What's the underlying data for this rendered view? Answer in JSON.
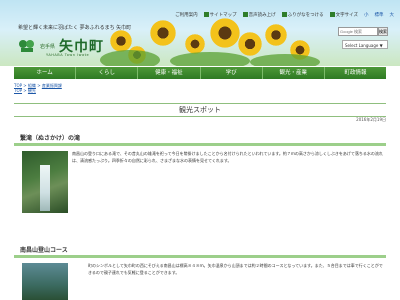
{
  "header": {
    "top_links": [
      "ご利用案内",
      "サイトマップ",
      "音声読み上げ",
      "ふりがなをつける",
      "文字サイズ",
      "小",
      "標準",
      "大"
    ],
    "tagline": "希望と輝く未来に羽ばたく 夢あふれるまち 矢巾町",
    "logo_prefix": "岩手県",
    "logo_name": "矢巾町",
    "logo_en": "YAHABA Town Iwate",
    "search_placeholder": "Google 検索",
    "search_button": "検索",
    "language_select": "Select Language ▼"
  },
  "nav": {
    "items": [
      "ホーム",
      "くらし",
      "健康・福祉",
      "学び",
      "観光・産業",
      "町政情報"
    ]
  },
  "breadcrumb": {
    "line1": [
      "TOP",
      "組織",
      "産業振興課"
    ],
    "line2": [
      "TOP",
      "観光"
    ]
  },
  "page": {
    "title": "観光スポット",
    "date": "2016年2月19日"
  },
  "sections": [
    {
      "heading": "繋滝（ぬさかけ）の滝",
      "body": "南昌山の登り口にある滝で、その昔丸山の雄滝を祀って今日を幣掛けましたことから名付けられたといわれています。約７ｍの高さから涼しくしぶきをあげて落ちる水の流れは、清流感たっぷり。四季折々の自然に彩られ、さまざまな水の表情を見せてくれます。"
    },
    {
      "heading": "南昌山登山コース",
      "body": "町のシンボルとして矢巾町の西にそびえる南昌山は標高８４８ｍ。矢巾温泉から山頂までは約２時間のコースとなっています。また、５合目までは車で行くことができるので親子連れでも気軽に登ることができます。"
    }
  ]
}
